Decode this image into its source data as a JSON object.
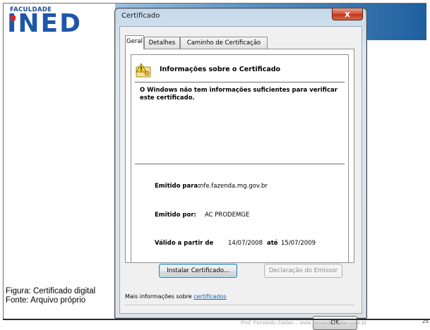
{
  "slide": {
    "logo": {
      "top_text": "FACULDADE",
      "main_text": "INED"
    },
    "caption": {
      "line1": "Figura: Certificado digital",
      "line2": "Fonte: Arquivo próprio"
    },
    "footer": {
      "text": "Prof. Fernando Zaidan – www.fernandozaidan.com.br",
      "page_number": "25"
    }
  },
  "dialog": {
    "title": "Certificado",
    "close_symbol": "x",
    "tabs": [
      {
        "label": "Geral",
        "active": true
      },
      {
        "label": "Detalhes",
        "active": false
      },
      {
        "label": "Caminho de Certificação",
        "active": false
      }
    ],
    "general": {
      "icon": "certificate-warning-icon",
      "heading": "Informações sobre o Certificado",
      "warning": "O Windows não tem informações suficientes para verificar este certificado.",
      "issued_to_label": "Emitido para:",
      "issued_to_value": "nfe.fazenda.mg.gov.br",
      "issued_by_label": "Emitido por:",
      "issued_by_value": "AC PRODEMGE",
      "valid_from_label": "Válido a partir de",
      "valid_from_value": "14/07/2008",
      "valid_to_label": "até",
      "valid_to_value": "15/07/2009"
    },
    "install_button": "Instalar Certificado...",
    "issuer_statement_button": "Declaração do Emissor",
    "more_info_prefix": "Mais informações sobre",
    "more_info_link": "certificados",
    "ok_button": "OK"
  }
}
